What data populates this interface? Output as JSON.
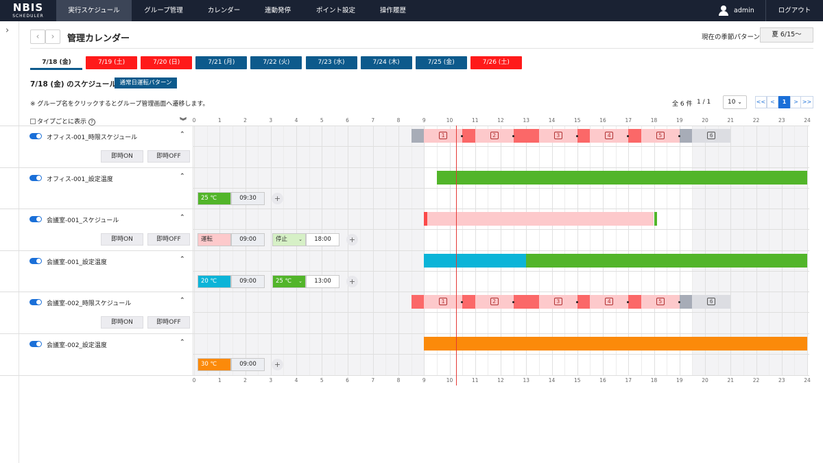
{
  "header": {
    "logo_main": "NBIS",
    "logo_sub": "SCHEDULER",
    "nav": [
      "実行スケジュール",
      "グループ管理",
      "カレンダー",
      "連動発停",
      "ポイント設定",
      "操作履歴"
    ],
    "user": "admin",
    "logout": "ログアウト"
  },
  "page": {
    "prev": "‹",
    "next": "›",
    "title": "管理カレンダー",
    "season_label": "現在の季節パターン",
    "season_value": "夏 6/15～"
  },
  "date_tabs": [
    {
      "label": "7/18 (金)",
      "style": "active"
    },
    {
      "label": "7/19 (土)",
      "style": "red"
    },
    {
      "label": "7/20 (日)",
      "style": "red"
    },
    {
      "label": "7/21 (月)",
      "style": "blue"
    },
    {
      "label": "7/22 (火)",
      "style": "blue"
    },
    {
      "label": "7/23 (水)",
      "style": "blue"
    },
    {
      "label": "7/24 (木)",
      "style": "blue"
    },
    {
      "label": "7/25 (金)",
      "style": "blue"
    },
    {
      "label": "7/26 (土)",
      "style": "red"
    }
  ],
  "schedule": {
    "title": "7/18 (金) のスケジュール",
    "pattern": "通常日運転パターン",
    "note": "※ グループ名をクリックするとグループ管理画面へ遷移します。",
    "count": "全 6 件",
    "page_info": "1 / 1",
    "per_page": "10",
    "pager": [
      "<<",
      "<",
      "1",
      ">",
      ">>"
    ],
    "type_toggle": "タイプごとに表示",
    "help": "?"
  },
  "hours": [
    "0",
    "1",
    "2",
    "3",
    "4",
    "5",
    "6",
    "7",
    "8",
    "9",
    "10",
    "11",
    "12",
    "13",
    "14",
    "15",
    "16",
    "17",
    "18",
    "19",
    "20",
    "21",
    "22",
    "23",
    "24"
  ],
  "current_time_hour": 10.25,
  "groups": [
    {
      "name": "オフィス-001_時限スケジュール",
      "type": "timed",
      "buttons": [
        "即時ON",
        "即時OFF"
      ],
      "segments": [
        {
          "from": 8.5,
          "to": 9.0,
          "color": "#a7acb7"
        },
        {
          "from": 9.0,
          "to": 10.5,
          "color": "#fdc9cb",
          "num": "1"
        },
        {
          "from": 10.5,
          "to": 11.0,
          "color": "#fb6868"
        },
        {
          "from": 11.0,
          "to": 12.5,
          "color": "#fdc9cb",
          "num": "2"
        },
        {
          "from": 12.5,
          "to": 13.5,
          "color": "#fb6868"
        },
        {
          "from": 13.5,
          "to": 15.0,
          "color": "#fdc9cb",
          "num": "3"
        },
        {
          "from": 15.0,
          "to": 15.5,
          "color": "#fb6868"
        },
        {
          "from": 15.5,
          "to": 17.0,
          "color": "#fdc9cb",
          "num": "4"
        },
        {
          "from": 17.0,
          "to": 17.5,
          "color": "#fb6868"
        },
        {
          "from": 17.5,
          "to": 19.0,
          "color": "#fdc9cb",
          "num": "5"
        },
        {
          "from": 19.0,
          "to": 19.5,
          "color": "#a7acb7"
        },
        {
          "from": 19.5,
          "to": 21.0,
          "color": "#dcdde2",
          "num": "6"
        }
      ]
    },
    {
      "name": "オフィス-001_設定温度",
      "type": "temp",
      "segments": [
        {
          "from": 9.5,
          "to": 24.0,
          "color": "#52b52a"
        }
      ],
      "chips": [
        {
          "value": "25 ℃",
          "color": "#52b52a",
          "time": "09:30"
        }
      ],
      "add": "+"
    },
    {
      "name": "会議室-001_スケジュール",
      "type": "onoff",
      "buttons": [
        "即時ON",
        "即時OFF"
      ],
      "segments": [
        {
          "from": 9.0,
          "to": 9.12,
          "color": "#fb4a4a"
        },
        {
          "from": 9.12,
          "to": 18.0,
          "color": "#fdc9cb"
        },
        {
          "from": 18.0,
          "to": 18.12,
          "color": "#52b52a"
        }
      ],
      "chips": [
        {
          "value": "運転",
          "color": "#fdc9cb",
          "time": "09:00"
        },
        {
          "value": "停止",
          "color": "#d6f0c6",
          "time": "18:00",
          "select": "⌄"
        }
      ],
      "add": "+"
    },
    {
      "name": "会議室-001_設定温度",
      "type": "temp",
      "segments": [
        {
          "from": 9.0,
          "to": 13.0,
          "color": "#0bb4d8"
        },
        {
          "from": 13.0,
          "to": 24.0,
          "color": "#52b52a"
        }
      ],
      "chips": [
        {
          "value": "20 ℃",
          "color": "#0bb4d8",
          "time": "09:00"
        },
        {
          "value": "25 ℃",
          "color": "#52b52a",
          "time": "13:00",
          "select": "⌄"
        }
      ],
      "add": "+"
    },
    {
      "name": "会議室-002_時限スケジュール",
      "type": "timed",
      "buttons": [
        "即時ON",
        "即時OFF"
      ],
      "segments": [
        {
          "from": 8.5,
          "to": 9.0,
          "color": "#fb6868"
        },
        {
          "from": 9.0,
          "to": 10.5,
          "color": "#fdc9cb",
          "num": "1"
        },
        {
          "from": 10.5,
          "to": 11.0,
          "color": "#fb6868"
        },
        {
          "from": 11.0,
          "to": 12.5,
          "color": "#fdc9cb",
          "num": "2"
        },
        {
          "from": 12.5,
          "to": 13.5,
          "color": "#fb6868"
        },
        {
          "from": 13.5,
          "to": 15.0,
          "color": "#fdc9cb",
          "num": "3"
        },
        {
          "from": 15.0,
          "to": 15.5,
          "color": "#fb6868"
        },
        {
          "from": 15.5,
          "to": 17.0,
          "color": "#fdc9cb",
          "num": "4"
        },
        {
          "from": 17.0,
          "to": 17.5,
          "color": "#fb6868"
        },
        {
          "from": 17.5,
          "to": 19.0,
          "color": "#fdc9cb",
          "num": "5"
        },
        {
          "from": 19.0,
          "to": 19.5,
          "color": "#a7acb7"
        },
        {
          "from": 19.5,
          "to": 21.0,
          "color": "#dcdde2",
          "num": "6"
        }
      ]
    },
    {
      "name": "会議室-002_設定温度",
      "type": "temp",
      "segments": [
        {
          "from": 9.0,
          "to": 24.0,
          "color": "#fb8a0a"
        }
      ],
      "chips": [
        {
          "value": "30 ℃",
          "color": "#fb8a0a",
          "time": "09:00"
        }
      ],
      "add": "+"
    }
  ]
}
